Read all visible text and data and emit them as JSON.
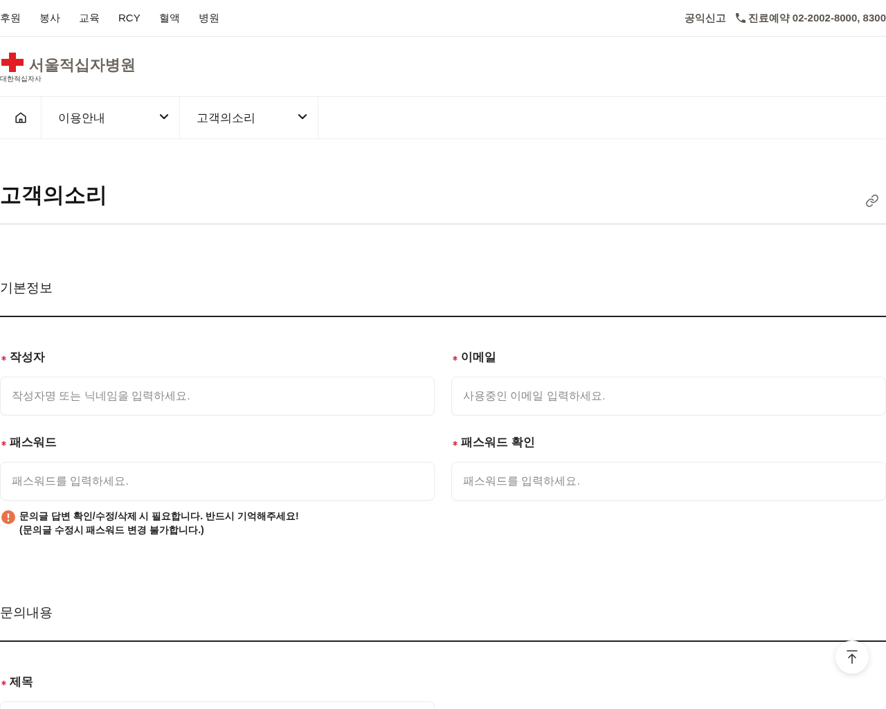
{
  "top_bar": {
    "links": [
      "후원",
      "봉사",
      "교육",
      "RCY",
      "혈액",
      "병원"
    ],
    "report_link": "공익신고",
    "reservation": "진료예약 02-2002-8000, 8300"
  },
  "logo": {
    "org": "대한적십자사",
    "name": "서울적십자병원"
  },
  "location_bar": {
    "dropdowns": [
      "이용안내",
      "고객의소리"
    ]
  },
  "page_title": "고객의소리",
  "sections": [
    {
      "title": "기본정보",
      "fields": [
        {
          "label": "작성자",
          "required": true,
          "placeholder": "작성자명 또는 닉네임을 입력하세요."
        },
        {
          "label": "이메일",
          "required": true,
          "placeholder": "사용중인 이메일 입력하세요."
        },
        {
          "label": "패스워드",
          "required": true,
          "placeholder": "패스워드를 입력하세요."
        },
        {
          "label": "패스워드 확인",
          "required": true,
          "placeholder": "패스워드를 입력하세요."
        }
      ],
      "note": "문의글 답변 확인/수정/삭제 시 필요합니다. 반드시 기억해주세요!\n(문의글 수정시 패스워드 변경 불가합니다.)"
    },
    {
      "title": "문의내용",
      "fields": [
        {
          "label": "제목",
          "required": true
        }
      ]
    }
  ]
}
